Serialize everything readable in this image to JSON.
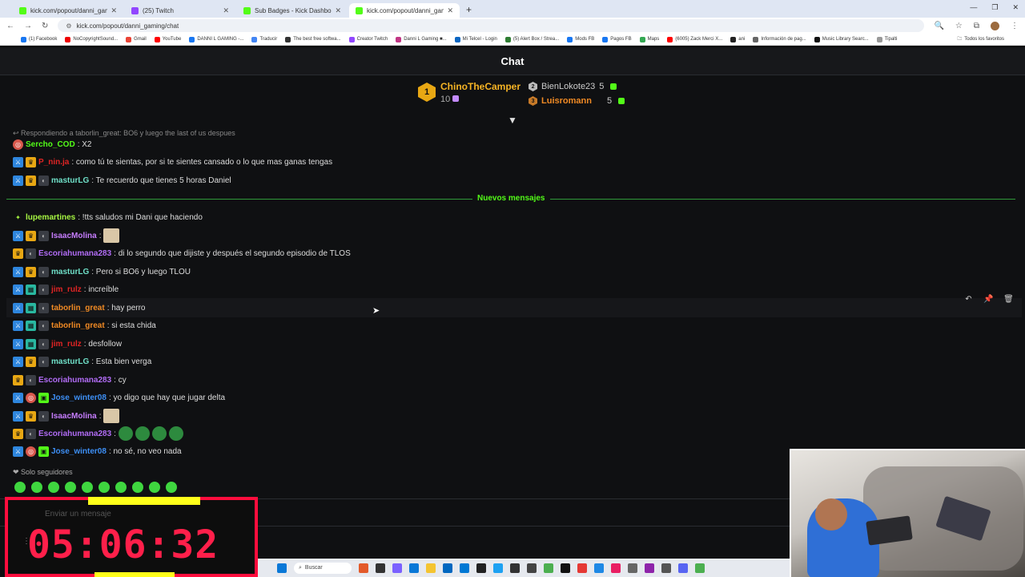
{
  "browser": {
    "tabs": [
      {
        "label": "kick.com/popout/danni_gaming/chat",
        "color": "#53fc18",
        "active": false
      },
      {
        "label": "(25) Twitch",
        "color": "#9146ff",
        "active": false
      },
      {
        "label": "Sub Badges - Kick Dashboard",
        "color": "#53fc18",
        "active": false
      },
      {
        "label": "kick.com/popout/danni_gaming/chat",
        "color": "#53fc18",
        "active": true
      }
    ],
    "url": "kick.com/popout/danni_gaming/chat",
    "bookmarks": [
      "(1) Facebook",
      "NoCopyrightSound...",
      "Gmail",
      "YouTube",
      "DANNI L GAMING -...",
      "Traducir",
      "The best free softwa...",
      "Creator Twitch",
      "Danni L Gaming ■...",
      "Mi Telcel - Login",
      "(5) Alert Box / Strea...",
      "Mods FB",
      "Pagos FB",
      "Maps",
      "(6005) Zack Merci X...",
      "ani",
      "Información de pag...",
      "Music Library Searc...",
      "Tipalti"
    ],
    "bookmarks_all": "Todos los favoritos"
  },
  "chat": {
    "title": "Chat",
    "leaderboard": {
      "first": {
        "rank": "1",
        "name": "ChinoTheCamper",
        "count": "10"
      },
      "others": [
        {
          "rank": "2",
          "name": "BienLokote23",
          "count": "5",
          "color": "#cccccc"
        },
        {
          "rank": "3",
          "name": "Luisromann",
          "count": "5",
          "color": "#f08a24"
        }
      ]
    },
    "reply_to": "Respondiendo a taborlin_great: BO6 y luego the last of us despues",
    "new_messages_label": "Nuevos mensajes",
    "messages": [
      {
        "user": "Sercho_COD",
        "text": ": X2",
        "color": "#53fc18"
      },
      {
        "user": "P_nin.ja",
        "text": ": como tú te sientas, por si te sientes cansado o lo que mas ganas tengas",
        "color": "#e02424"
      },
      {
        "user": "masturLG",
        "text": ": Te recuerdo que tienes 5 horas Daniel",
        "color": "#6fe0c8"
      },
      {
        "user": "lupemartines",
        "text": ": !tts saludos mi Dani que haciendo",
        "color": "#a6f542"
      },
      {
        "user": "IsaacMolina",
        "text": ":",
        "color": "#c77dff"
      },
      {
        "user": "Escoriahumana283",
        "text": ": di lo segundo que dijiste y después el segundo episodio de TLOS",
        "color": "#b16cf5"
      },
      {
        "user": "masturLG",
        "text": ": Pero si BO6 y luego TLOU",
        "color": "#6fe0c8"
      },
      {
        "user": "jim_rulz",
        "text": ": increíble",
        "color": "#e02424"
      },
      {
        "user": "taborlin_great",
        "text": ": hay perro",
        "color": "#f08a24"
      },
      {
        "user": "taborlin_great",
        "text": ": si esta chida",
        "color": "#f08a24"
      },
      {
        "user": "jim_rulz",
        "text": ": desfollow",
        "color": "#e02424"
      },
      {
        "user": "masturLG",
        "text": ": Esta bien verga",
        "color": "#6fe0c8"
      },
      {
        "user": "Escoriahumana283",
        "text": ": cy",
        "color": "#b16cf5"
      },
      {
        "user": "Jose_winter08",
        "text": ": yo digo que hay que jugar delta",
        "color": "#3d8ff5"
      },
      {
        "user": "IsaacMolina",
        "text": ":",
        "color": "#c77dff"
      },
      {
        "user": "Escoriahumana283",
        "text": ":",
        "color": "#b16cf5"
      },
      {
        "user": "Jose_winter08",
        "text": ": no sé, no veo nada",
        "color": "#3d8ff5"
      }
    ],
    "followers_only": "Solo seguidores",
    "input_placeholder": "Enviar un mensaje"
  },
  "overlay": {
    "timer": "05:06:32"
  },
  "taskbar": {
    "search": "Buscar"
  }
}
